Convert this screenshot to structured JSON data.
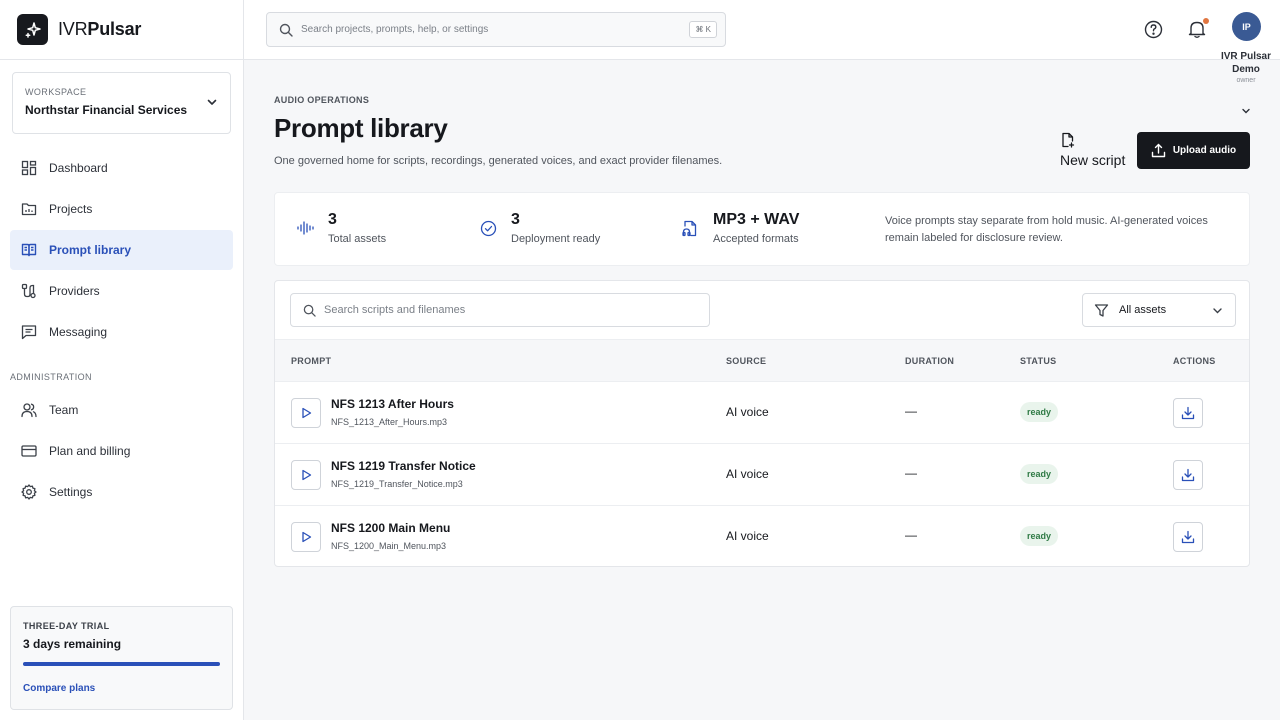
{
  "brand": {
    "name_light": "IVR",
    "name_bold": "Pulsar"
  },
  "workspace": {
    "label": "WORKSPACE",
    "name": "Northstar Financial Services"
  },
  "sidebar": {
    "items": [
      {
        "label": "Dashboard",
        "icon": "dashboard-icon"
      },
      {
        "label": "Projects",
        "icon": "folder-icon"
      },
      {
        "label": "Prompt library",
        "icon": "book-icon",
        "active": true
      },
      {
        "label": "Providers",
        "icon": "route-icon"
      },
      {
        "label": "Messaging",
        "icon": "message-icon"
      }
    ],
    "admin_label": "ADMINISTRATION",
    "admin_items": [
      {
        "label": "Team",
        "icon": "users-icon"
      },
      {
        "label": "Plan and billing",
        "icon": "credit-card-icon"
      },
      {
        "label": "Settings",
        "icon": "gear-icon"
      }
    ]
  },
  "trial": {
    "label": "THREE-DAY TRIAL",
    "remaining": "3 days remaining",
    "progress": 1.0,
    "link": "Compare plans"
  },
  "topbar": {
    "search_placeholder": "Search projects, prompts, help, or settings",
    "shortcut": "⌘ K",
    "avatar_initials": "IP",
    "user_name": "IVR Pulsar Demo",
    "user_role": "owner"
  },
  "page": {
    "eyebrow": "AUDIO OPERATIONS",
    "title": "Prompt library",
    "subtitle": "One governed home for scripts, recordings, generated voices, and exact provider filenames.",
    "new_script": "New script",
    "upload": "Upload audio"
  },
  "stats": [
    {
      "value": "3",
      "label": "Total assets",
      "icon": "waveform-icon"
    },
    {
      "value": "3",
      "label": "Deployment ready",
      "icon": "check-circle-icon"
    },
    {
      "value": "MP3 + WAV",
      "label": "Accepted formats",
      "icon": "audio-file-icon"
    }
  ],
  "stats_note": "Voice prompts stay separate from hold music. AI-generated voices remain labeled for disclosure review.",
  "table": {
    "search_placeholder": "Search scripts and filenames",
    "filter": "All assets",
    "columns": [
      "PROMPT",
      "SOURCE",
      "DURATION",
      "STATUS",
      "ACTIONS"
    ],
    "rows": [
      {
        "name": "NFS 1213 After Hours",
        "file": "NFS_1213_After_Hours.mp3",
        "source": "AI voice",
        "duration": "—",
        "status": "ready"
      },
      {
        "name": "NFS 1219 Transfer Notice",
        "file": "NFS_1219_Transfer_Notice.mp3",
        "source": "AI voice",
        "duration": "—",
        "status": "ready"
      },
      {
        "name": "NFS 1200 Main Menu",
        "file": "NFS_1200_Main_Menu.mp3",
        "source": "AI voice",
        "duration": "—",
        "status": "ready"
      }
    ]
  },
  "colors": {
    "accent": "#2a50b8",
    "dark": "#16181d",
    "ready_bg": "#e9f4ec",
    "ready_text": "#2f7a45",
    "notification_dot": "#e07540"
  }
}
